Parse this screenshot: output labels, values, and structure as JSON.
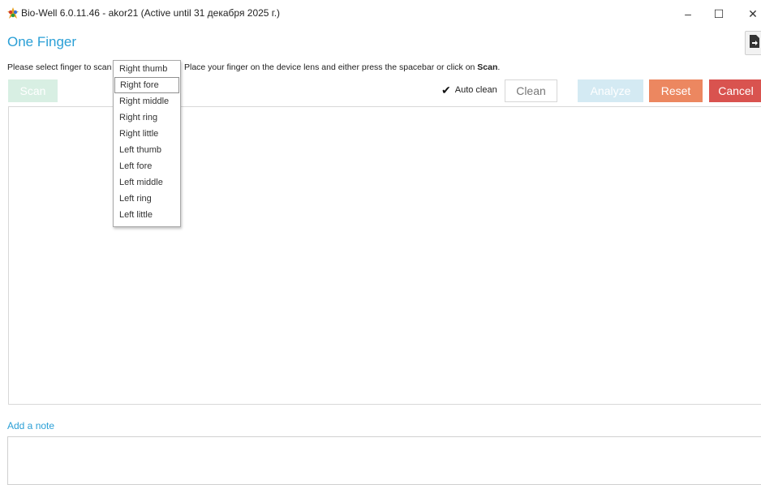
{
  "window": {
    "title": "Bio-Well 6.0.11.46 - akor21 (Active until 31 декабря 2025 г.)",
    "minimize": "–",
    "maximize": "☐",
    "close": "✕",
    "icon": "bio-well-logo-icon"
  },
  "page": {
    "title": "One Finger"
  },
  "instructions": {
    "prefix": "Please select finger to scan",
    "suffix": "Place your finger on the device lens and either press the spacebar or click on",
    "scan_word": "Scan",
    "period": "."
  },
  "finger_select": {
    "selected": "Right fore",
    "options": [
      "Right thumb",
      "Right fore",
      "Right middle",
      "Right ring",
      "Right little",
      "Left thumb",
      "Left fore",
      "Left middle",
      "Left ring",
      "Left little"
    ]
  },
  "toolbar": {
    "scan_label": "Scan",
    "auto_clean_label": "Auto clean",
    "auto_clean_checked": true,
    "clean_label": "Clean",
    "analyze_label": "Analyze",
    "reset_label": "Reset",
    "cancel_label": "Cancel"
  },
  "note": {
    "label": "Add a note",
    "value": ""
  },
  "colors": {
    "accent_blue": "#2a9fd6",
    "scan_disabled": "#d8efe3",
    "analyze_disabled": "#d4eaf3",
    "reset": "#ec8760",
    "cancel": "#d9534f"
  }
}
